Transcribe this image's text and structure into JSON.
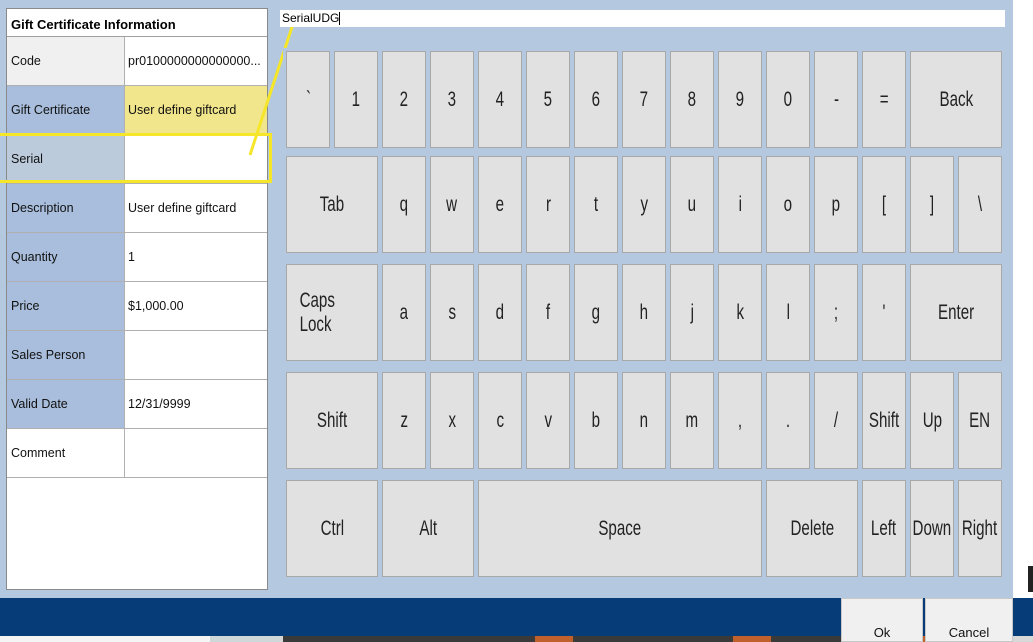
{
  "panel": {
    "title": "Gift Certificate Information",
    "rows": [
      {
        "label": "Code",
        "value": "pr0100000000000000..."
      },
      {
        "label": "Gift Certificate",
        "value": "User define giftcard"
      },
      {
        "label": "Serial",
        "value": ""
      },
      {
        "label": "Description",
        "value": "User define giftcard"
      },
      {
        "label": "Quantity",
        "value": "1"
      },
      {
        "label": "Price",
        "value": "$1,000.00"
      },
      {
        "label": "Sales Person",
        "value": ""
      },
      {
        "label": "Valid Date",
        "value": "12/31/9999"
      },
      {
        "label": "Comment",
        "value": ""
      }
    ]
  },
  "input": {
    "value": "SerialUDG"
  },
  "keyboard": {
    "rows": [
      [
        "`",
        "1",
        "2",
        "3",
        "4",
        "5",
        "6",
        "7",
        "8",
        "9",
        "0",
        "-",
        "=",
        "Back"
      ],
      [
        "Tab",
        "q",
        "w",
        "e",
        "r",
        "t",
        "y",
        "u",
        "i",
        "o",
        "p",
        "[",
        "]",
        "\\"
      ],
      [
        "Caps Lock",
        "a",
        "s",
        "d",
        "f",
        "g",
        "h",
        "j",
        "k",
        "l",
        ";",
        "'",
        "Enter"
      ],
      [
        "Shift",
        "z",
        "x",
        "c",
        "v",
        "b",
        "n",
        "m",
        ",",
        ".",
        "/",
        "Shift",
        "Up",
        "EN"
      ],
      [
        "Ctrl",
        "Alt",
        "Space",
        "Delete",
        "Left",
        "Down",
        "Right"
      ]
    ]
  },
  "buttons": {
    "ok": "Ok",
    "cancel": "Cancel"
  },
  "colors": {
    "accent_bar": "#063d78",
    "highlight": "#f5e62a",
    "field_highlight": "#f2e68c"
  }
}
